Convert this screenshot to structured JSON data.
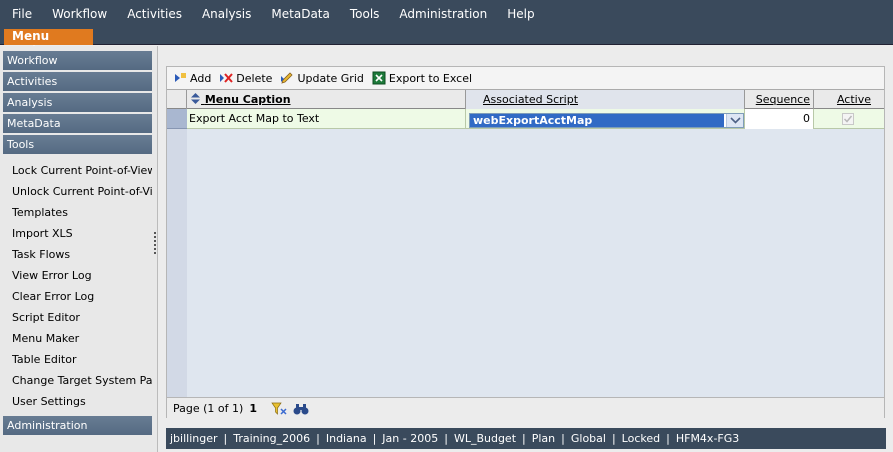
{
  "menubar": {
    "items": [
      "File",
      "Workflow",
      "Activities",
      "Analysis",
      "MetaData",
      "Tools",
      "Administration",
      "Help"
    ]
  },
  "tab": {
    "label": "Menu Maker"
  },
  "sidebar": {
    "sections": [
      "Workflow",
      "Activities",
      "Analysis",
      "MetaData",
      "Tools"
    ],
    "tools_items": [
      "Lock Current Point-of-View",
      "Unlock Current Point-of-View",
      "Templates",
      "Import XLS",
      "Task Flows",
      "View Error Log",
      "Clear Error Log",
      "Script Editor",
      "Menu Maker",
      "Table Editor",
      "Change Target System Passw",
      "User Settings"
    ],
    "bottom_section": "Administration"
  },
  "toolbar": {
    "add": "Add",
    "delete": "Delete",
    "update": "Update Grid",
    "export": "Export to Excel"
  },
  "grid": {
    "columns": [
      "Menu Caption",
      "Associated Script",
      "Sequence",
      "Active"
    ],
    "rows": [
      {
        "caption": "Export Acct Map to Text",
        "script": "webExportAcctMap",
        "sequence": "0",
        "active": true
      }
    ]
  },
  "pager": {
    "text": "Page (1 of 1)",
    "current": "1"
  },
  "status": {
    "items": [
      "jbillinger",
      "Training_2006",
      "Indiana",
      "Jan - 2005",
      "WL_Budget",
      "Plan",
      "Global",
      "Locked",
      "HFM4x-FG3"
    ]
  }
}
